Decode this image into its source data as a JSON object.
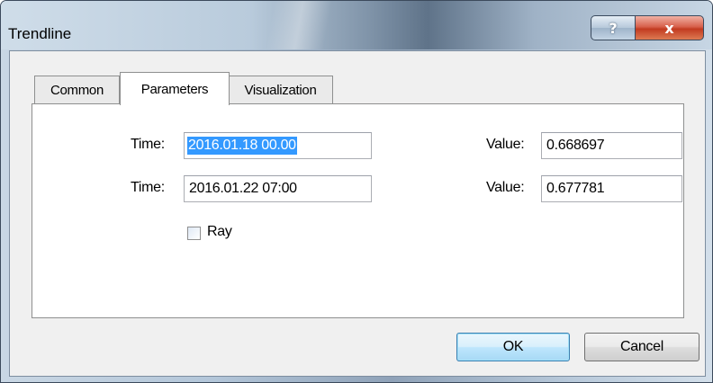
{
  "window": {
    "title": "Trendline",
    "help_icon": "?",
    "close_icon": "x"
  },
  "tabs": [
    {
      "label": "Common"
    },
    {
      "label": "Parameters"
    },
    {
      "label": "Visualization"
    }
  ],
  "active_tab": "Parameters",
  "params": {
    "time1_label": "Time:",
    "time1_value": "2016.01.18 00.00",
    "time2_label": "Time:",
    "time2_value": "2016.01.22 07:00",
    "value1_label": "Value:",
    "value1_value": "0.668697",
    "value2_label": "Value:",
    "value2_value": "0.677781",
    "ray_label": "Ray",
    "ray_checked": false
  },
  "buttons": {
    "ok": "OK",
    "cancel": "Cancel"
  },
  "colors": {
    "selection": "#3399ff",
    "close_button": "#c23b21",
    "default_button_border": "#3c7fb1"
  }
}
